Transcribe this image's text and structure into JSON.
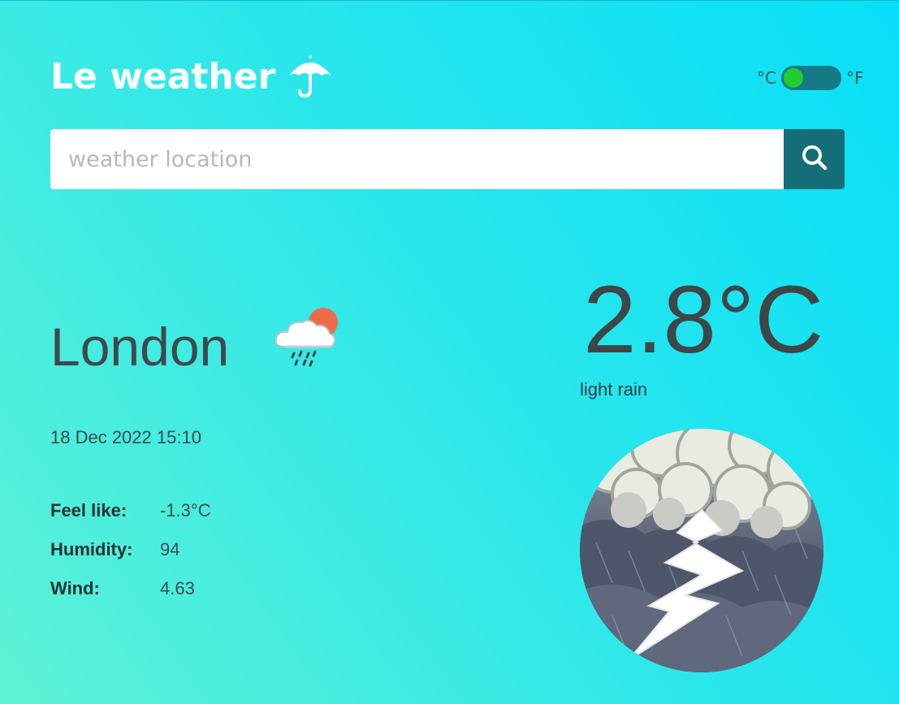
{
  "header": {
    "title": "Le weather",
    "icon": "umbrella-icon"
  },
  "unit_toggle": {
    "celsius_label": "°C",
    "fahrenheit_label": "°F",
    "selected": "°C"
  },
  "search": {
    "placeholder": "weather location",
    "value": "",
    "button_icon": "search-icon"
  },
  "weather": {
    "city": "London",
    "condition_icon": "rain-cloud-sun-icon",
    "datetime": "18 Dec 2022 15:10",
    "temperature": "2.8°C",
    "description": "light rain",
    "image": "thunderstorm-illustration"
  },
  "details": [
    {
      "label": "Feel like:",
      "value": "-1.3°C"
    },
    {
      "label": "Humidity:",
      "value": "94"
    },
    {
      "label": "Wind:",
      "value": "4.63"
    }
  ],
  "colors": {
    "gradient_start": "#08dff8",
    "gradient_end": "#5ef2d5",
    "search_button": "#146e78",
    "toggle_track": "#137a86",
    "toggle_knob": "#21cc2e",
    "text_dark": "#3e4a4c"
  }
}
